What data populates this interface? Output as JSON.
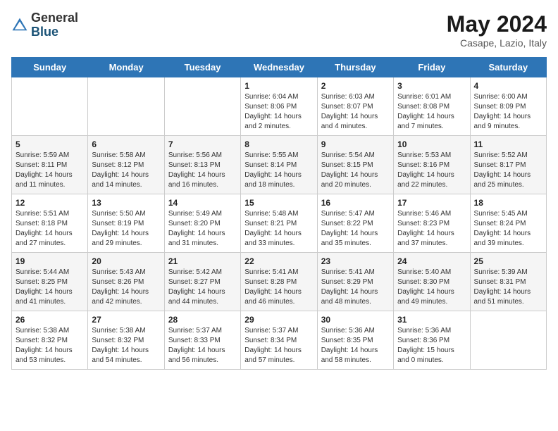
{
  "logo": {
    "general": "General",
    "blue": "Blue"
  },
  "title": "May 2024",
  "location": "Casape, Lazio, Italy",
  "days_header": [
    "Sunday",
    "Monday",
    "Tuesday",
    "Wednesday",
    "Thursday",
    "Friday",
    "Saturday"
  ],
  "weeks": [
    [
      {
        "day": "",
        "sunrise": "",
        "sunset": "",
        "daylight": ""
      },
      {
        "day": "",
        "sunrise": "",
        "sunset": "",
        "daylight": ""
      },
      {
        "day": "",
        "sunrise": "",
        "sunset": "",
        "daylight": ""
      },
      {
        "day": "1",
        "sunrise": "Sunrise: 6:04 AM",
        "sunset": "Sunset: 8:06 PM",
        "daylight": "Daylight: 14 hours and 2 minutes."
      },
      {
        "day": "2",
        "sunrise": "Sunrise: 6:03 AM",
        "sunset": "Sunset: 8:07 PM",
        "daylight": "Daylight: 14 hours and 4 minutes."
      },
      {
        "day": "3",
        "sunrise": "Sunrise: 6:01 AM",
        "sunset": "Sunset: 8:08 PM",
        "daylight": "Daylight: 14 hours and 7 minutes."
      },
      {
        "day": "4",
        "sunrise": "Sunrise: 6:00 AM",
        "sunset": "Sunset: 8:09 PM",
        "daylight": "Daylight: 14 hours and 9 minutes."
      }
    ],
    [
      {
        "day": "5",
        "sunrise": "Sunrise: 5:59 AM",
        "sunset": "Sunset: 8:11 PM",
        "daylight": "Daylight: 14 hours and 11 minutes."
      },
      {
        "day": "6",
        "sunrise": "Sunrise: 5:58 AM",
        "sunset": "Sunset: 8:12 PM",
        "daylight": "Daylight: 14 hours and 14 minutes."
      },
      {
        "day": "7",
        "sunrise": "Sunrise: 5:56 AM",
        "sunset": "Sunset: 8:13 PM",
        "daylight": "Daylight: 14 hours and 16 minutes."
      },
      {
        "day": "8",
        "sunrise": "Sunrise: 5:55 AM",
        "sunset": "Sunset: 8:14 PM",
        "daylight": "Daylight: 14 hours and 18 minutes."
      },
      {
        "day": "9",
        "sunrise": "Sunrise: 5:54 AM",
        "sunset": "Sunset: 8:15 PM",
        "daylight": "Daylight: 14 hours and 20 minutes."
      },
      {
        "day": "10",
        "sunrise": "Sunrise: 5:53 AM",
        "sunset": "Sunset: 8:16 PM",
        "daylight": "Daylight: 14 hours and 22 minutes."
      },
      {
        "day": "11",
        "sunrise": "Sunrise: 5:52 AM",
        "sunset": "Sunset: 8:17 PM",
        "daylight": "Daylight: 14 hours and 25 minutes."
      }
    ],
    [
      {
        "day": "12",
        "sunrise": "Sunrise: 5:51 AM",
        "sunset": "Sunset: 8:18 PM",
        "daylight": "Daylight: 14 hours and 27 minutes."
      },
      {
        "day": "13",
        "sunrise": "Sunrise: 5:50 AM",
        "sunset": "Sunset: 8:19 PM",
        "daylight": "Daylight: 14 hours and 29 minutes."
      },
      {
        "day": "14",
        "sunrise": "Sunrise: 5:49 AM",
        "sunset": "Sunset: 8:20 PM",
        "daylight": "Daylight: 14 hours and 31 minutes."
      },
      {
        "day": "15",
        "sunrise": "Sunrise: 5:48 AM",
        "sunset": "Sunset: 8:21 PM",
        "daylight": "Daylight: 14 hours and 33 minutes."
      },
      {
        "day": "16",
        "sunrise": "Sunrise: 5:47 AM",
        "sunset": "Sunset: 8:22 PM",
        "daylight": "Daylight: 14 hours and 35 minutes."
      },
      {
        "day": "17",
        "sunrise": "Sunrise: 5:46 AM",
        "sunset": "Sunset: 8:23 PM",
        "daylight": "Daylight: 14 hours and 37 minutes."
      },
      {
        "day": "18",
        "sunrise": "Sunrise: 5:45 AM",
        "sunset": "Sunset: 8:24 PM",
        "daylight": "Daylight: 14 hours and 39 minutes."
      }
    ],
    [
      {
        "day": "19",
        "sunrise": "Sunrise: 5:44 AM",
        "sunset": "Sunset: 8:25 PM",
        "daylight": "Daylight: 14 hours and 41 minutes."
      },
      {
        "day": "20",
        "sunrise": "Sunrise: 5:43 AM",
        "sunset": "Sunset: 8:26 PM",
        "daylight": "Daylight: 14 hours and 42 minutes."
      },
      {
        "day": "21",
        "sunrise": "Sunrise: 5:42 AM",
        "sunset": "Sunset: 8:27 PM",
        "daylight": "Daylight: 14 hours and 44 minutes."
      },
      {
        "day": "22",
        "sunrise": "Sunrise: 5:41 AM",
        "sunset": "Sunset: 8:28 PM",
        "daylight": "Daylight: 14 hours and 46 minutes."
      },
      {
        "day": "23",
        "sunrise": "Sunrise: 5:41 AM",
        "sunset": "Sunset: 8:29 PM",
        "daylight": "Daylight: 14 hours and 48 minutes."
      },
      {
        "day": "24",
        "sunrise": "Sunrise: 5:40 AM",
        "sunset": "Sunset: 8:30 PM",
        "daylight": "Daylight: 14 hours and 49 minutes."
      },
      {
        "day": "25",
        "sunrise": "Sunrise: 5:39 AM",
        "sunset": "Sunset: 8:31 PM",
        "daylight": "Daylight: 14 hours and 51 minutes."
      }
    ],
    [
      {
        "day": "26",
        "sunrise": "Sunrise: 5:38 AM",
        "sunset": "Sunset: 8:32 PM",
        "daylight": "Daylight: 14 hours and 53 minutes."
      },
      {
        "day": "27",
        "sunrise": "Sunrise: 5:38 AM",
        "sunset": "Sunset: 8:32 PM",
        "daylight": "Daylight: 14 hours and 54 minutes."
      },
      {
        "day": "28",
        "sunrise": "Sunrise: 5:37 AM",
        "sunset": "Sunset: 8:33 PM",
        "daylight": "Daylight: 14 hours and 56 minutes."
      },
      {
        "day": "29",
        "sunrise": "Sunrise: 5:37 AM",
        "sunset": "Sunset: 8:34 PM",
        "daylight": "Daylight: 14 hours and 57 minutes."
      },
      {
        "day": "30",
        "sunrise": "Sunrise: 5:36 AM",
        "sunset": "Sunset: 8:35 PM",
        "daylight": "Daylight: 14 hours and 58 minutes."
      },
      {
        "day": "31",
        "sunrise": "Sunrise: 5:36 AM",
        "sunset": "Sunset: 8:36 PM",
        "daylight": "Daylight: 15 hours and 0 minutes."
      },
      {
        "day": "",
        "sunrise": "",
        "sunset": "",
        "daylight": ""
      }
    ]
  ]
}
